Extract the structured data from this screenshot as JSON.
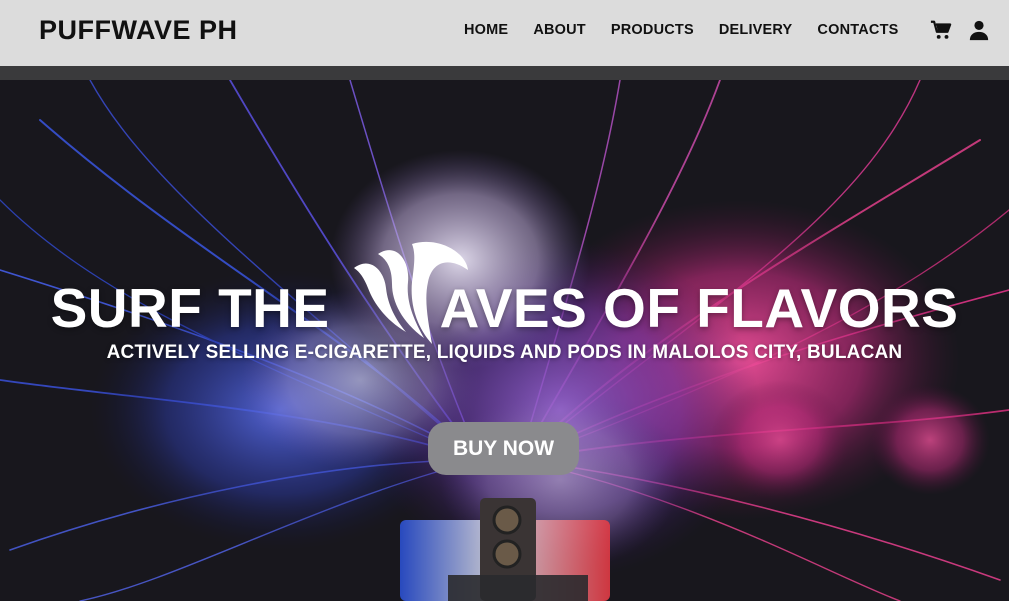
{
  "brand": {
    "name": "PUFFWAVE PH"
  },
  "nav": {
    "items": [
      {
        "label": "HOME"
      },
      {
        "label": "ABOUT"
      },
      {
        "label": "PRODUCTS"
      },
      {
        "label": "DELIVERY"
      },
      {
        "label": "CONTACTS"
      }
    ],
    "icons": [
      "cart-icon",
      "user-icon"
    ]
  },
  "hero": {
    "title_left": "SURF THE",
    "title_right": "AVES OF FLAVORS",
    "subtitle": "ACTIVELY SELLING E-CIGARETTE, LIQUIDS AND PODS IN MALOLOS CITY, BULACAN",
    "cta_label": "BUY NOW",
    "logo": "wave-logo-icon"
  },
  "colors": {
    "navbar_bg": "#dcdcdc",
    "band": "#3a3a3c",
    "cta_bg": "#8a8a8d",
    "text_light": "#ffffff",
    "text_dark": "#111111"
  }
}
